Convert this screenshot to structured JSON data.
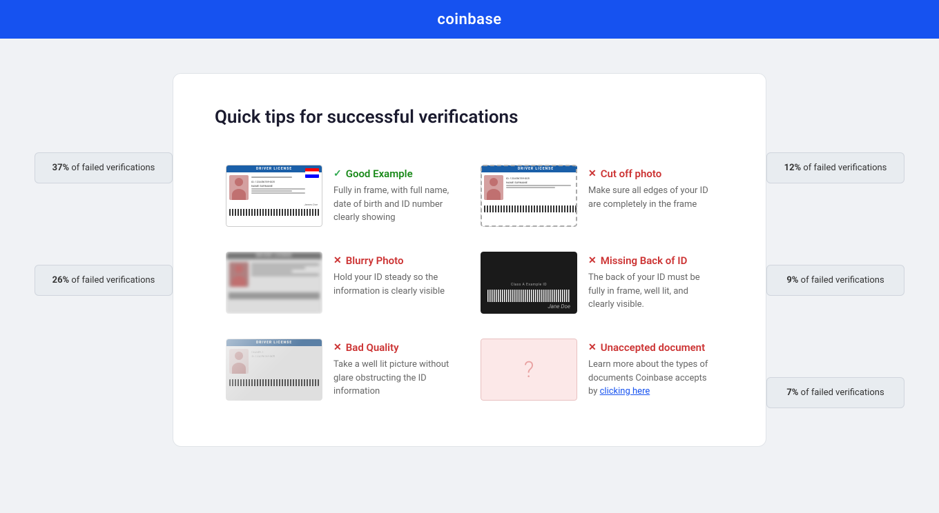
{
  "header": {
    "logo": "coinbase"
  },
  "page": {
    "title": "Quick tips for successful verifications"
  },
  "left_badges": [
    {
      "percent": "37%",
      "label": "of failed verifications"
    },
    {
      "percent": "26%",
      "label": "of failed verifications"
    }
  ],
  "right_badges": [
    {
      "percent": "12%",
      "label": "of failed verifications"
    },
    {
      "percent": "9%",
      "label": "of failed verifications"
    },
    {
      "percent": "7%",
      "label": "of failed verifications"
    }
  ],
  "tips": [
    {
      "type": "good",
      "icon": "check",
      "title": "Good Example",
      "description": "Fully in frame, with full name, date of birth and ID number clearly showing",
      "image_type": "id-good"
    },
    {
      "type": "bad",
      "icon": "x",
      "title": "Cut off photo",
      "description": "Make sure all edges of your ID are completely in the frame",
      "image_type": "id-cutoff"
    },
    {
      "type": "bad",
      "icon": "x",
      "title": "Blurry Photo",
      "description": "Hold your ID steady so the information is clearly visible",
      "image_type": "id-blurry"
    },
    {
      "type": "bad",
      "icon": "x",
      "title": "Missing Back of ID",
      "description": "The back of your ID must be fully in frame, well lit, and clearly visible.",
      "image_type": "id-back"
    },
    {
      "type": "bad",
      "icon": "x",
      "title": "Bad Quality",
      "description": "Take a well lit picture without glare obstructing the ID information",
      "image_type": "id-bad-quality"
    },
    {
      "type": "bad",
      "icon": "x",
      "title": "Unaccepted document",
      "description": "Learn more about the types of documents Coinbase accepts by",
      "link_text": "clicking here",
      "image_type": "id-unaccepted"
    }
  ]
}
